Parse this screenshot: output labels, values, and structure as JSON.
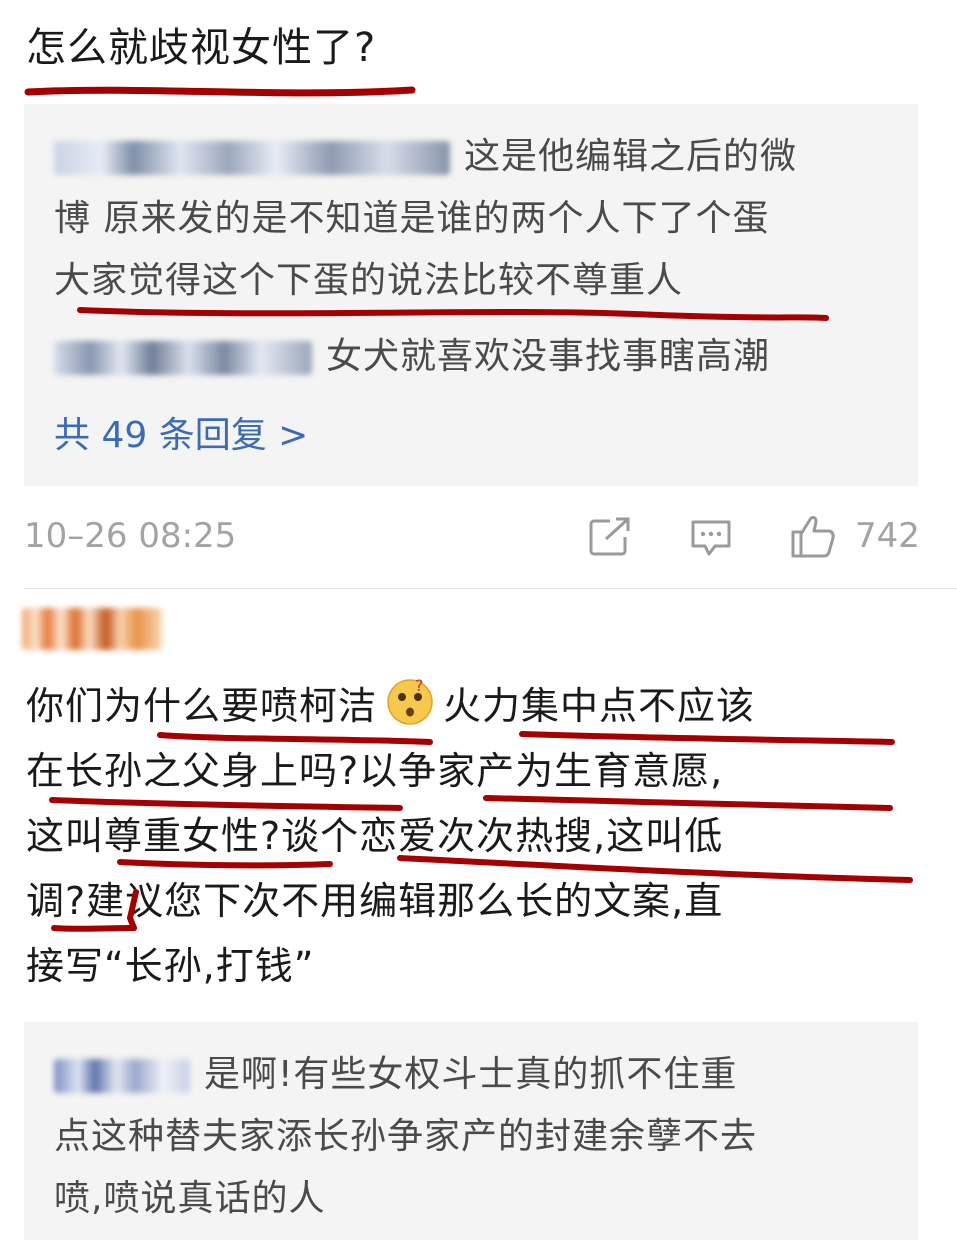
{
  "comment1": {
    "text": "怎么就歧视女性了?",
    "replies": [
      {
        "text_line1": "这是他编辑之后的微",
        "text_line2": "博 原来发的是不知道是谁的两个人下了个蛋",
        "text_line3": "大家觉得这个下蛋的说法比较不尊重人"
      },
      {
        "text": "女犬就喜欢没事找事瞎高潮"
      }
    ],
    "more_replies": "共 49 条回复 >",
    "timestamp": "10–26 08:25",
    "like_count": "742"
  },
  "comment2": {
    "lines": [
      "你们为什么要喷柯洁",
      "火力集中点不应该",
      "在长孙之父身上吗?以争家产为生育意愿,",
      "这叫尊重女性?谈个恋爱次次热搜,这叫低",
      "调?建议您下次不用编辑那么长的文案,直",
      "接写“长孙,打钱”"
    ],
    "reply": {
      "line1": "是啊!有些女权斗士真的抓不住重",
      "line2": "点这种替夫家添长孙争家产的封建余孽不去",
      "line3": "喷,喷说真话的人"
    }
  },
  "colors": {
    "underline": "#a40000",
    "reply_bg": "#f4f4f4",
    "link": "#3a6bb3",
    "meta": "#a3a3a3"
  }
}
